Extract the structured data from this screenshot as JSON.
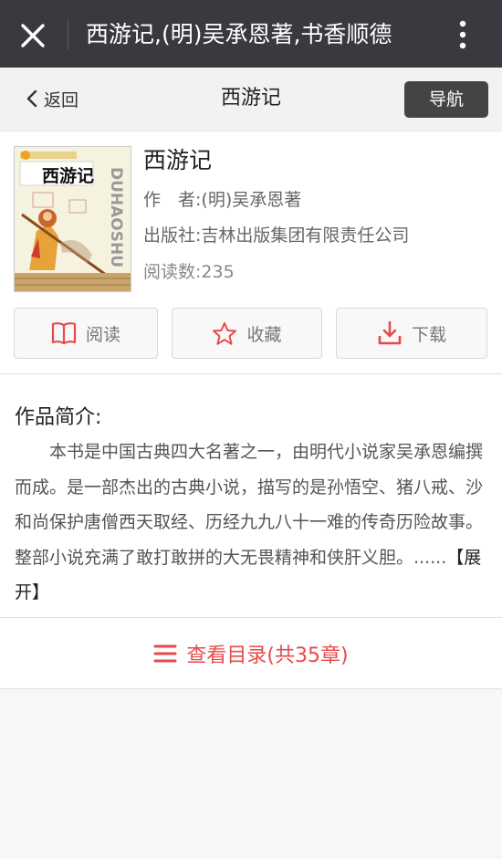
{
  "topbar": {
    "title": "西游记,(明)吴承恩著,书香顺德",
    "close_icon": "close-icon",
    "more_icon": "more-vertical-icon",
    "background": "#393a3f"
  },
  "nav": {
    "back_label": "返回",
    "title": "西游记",
    "guide_label": "导航"
  },
  "book": {
    "title": "西游记",
    "author": "作　者:(明)吴承恩著",
    "publisher": "出版社:吉林出版集团有限责任公司",
    "reads": "阅读数:235",
    "cover": {
      "title_text": "西游记",
      "side_text": "DUHAOSHU"
    }
  },
  "actions": {
    "read_label": "阅读",
    "favorite_label": "收藏",
    "download_label": "下载"
  },
  "intro": {
    "heading": "作品简介:",
    "text": "本书是中国古典四大名著之一，由明代小说家吴承恩编撰而成。是一部杰出的古典小说，描写的是孙悟空、猪八戒、沙和尚保护唐僧西天取经、历经九九八十一难的传奇历险故事。整部小说充满了敢打敢拼的大无畏精神和侠肝义胆。......",
    "expand_label": "【展开】"
  },
  "toc": {
    "label": "查看目录(共35章)",
    "accent": "#e84a4a"
  },
  "colors": {
    "accent": "#e84a4a",
    "dark_button": "#444444"
  }
}
